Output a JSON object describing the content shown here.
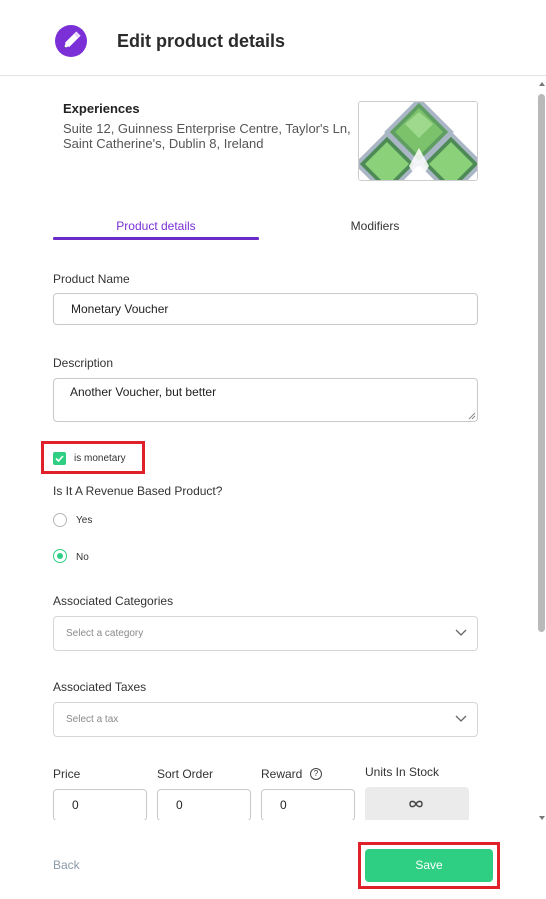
{
  "header": {
    "title": "Edit product details",
    "icon": "edit-pencil-icon",
    "icon_color": "#7b2fd6"
  },
  "experience": {
    "title": "Experiences",
    "address": "Suite 12, Guinness Enterprise Centre, Taylor's Ln, Saint Catherine's, Dublin 8, Ireland"
  },
  "tabs": [
    {
      "label": "Product details",
      "active": true
    },
    {
      "label": "Modifiers",
      "active": false
    }
  ],
  "form": {
    "product_name_label": "Product Name",
    "product_name_value": "Monetary Voucher",
    "description_label": "Description",
    "description_value": "Another Voucher, but better",
    "is_monetary_label": "is monetary",
    "is_monetary_checked": true,
    "revenue_question": "Is It A Revenue Based Product?",
    "revenue_options": [
      {
        "label": "Yes",
        "selected": false
      },
      {
        "label": "No",
        "selected": true
      }
    ],
    "categories_label": "Associated Categories",
    "categories_placeholder": "Select a category",
    "taxes_label": "Associated Taxes",
    "taxes_placeholder": "Select a tax",
    "price_label": "Price",
    "price_value": "0",
    "sort_order_label": "Sort Order",
    "sort_order_value": "0",
    "reward_label": "Reward",
    "reward_value": "0",
    "units_in_stock_label": "Units In Stock",
    "units_in_stock_icon": "infinity-icon"
  },
  "footer": {
    "back_label": "Back",
    "save_label": "Save"
  },
  "colors": {
    "accent": "#7b2fd6",
    "success": "#2fcf83",
    "highlight": "#e0202a"
  }
}
